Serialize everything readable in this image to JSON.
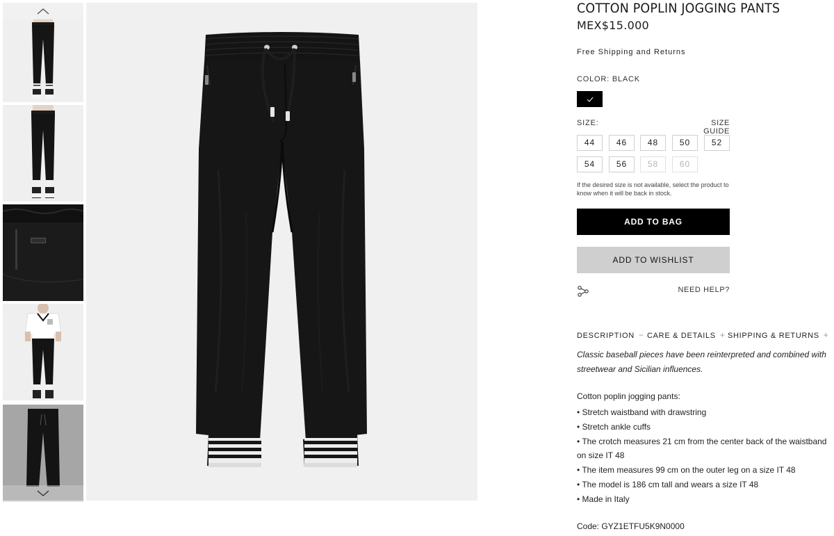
{
  "gallery": {
    "thumbnails": [
      {
        "alt": "front view model"
      },
      {
        "alt": "front view model"
      },
      {
        "alt": "waistband detail"
      },
      {
        "alt": "model with t-shirt"
      },
      {
        "alt": "flat product view"
      }
    ]
  },
  "product": {
    "title": "COTTON POPLIN JOGGING PANTS",
    "price": "MEX$15.000",
    "shipping_note": "Free Shipping and Returns",
    "color_label": "COLOR: BLACK",
    "color_hex": "#000000",
    "size_label": "SIZE:",
    "size_guide": "SIZE GUIDE",
    "sizes": [
      {
        "label": "44",
        "available": true
      },
      {
        "label": "46",
        "available": true
      },
      {
        "label": "48",
        "available": true
      },
      {
        "label": "50",
        "available": true
      },
      {
        "label": "52",
        "available": true
      },
      {
        "label": "54",
        "available": true
      },
      {
        "label": "56",
        "available": true
      },
      {
        "label": "58",
        "available": false
      },
      {
        "label": "60",
        "available": false
      }
    ],
    "size_note": "If the desired size is not available, select the product to know when it will be back in stock.",
    "add_to_bag": "ADD TO BAG",
    "add_to_wishlist": "ADD TO WISHLIST",
    "need_help": "NEED HELP?"
  },
  "tabs": [
    {
      "label": "DESCRIPTION",
      "sign": "−"
    },
    {
      "label": "CARE & DETAILS",
      "sign": "+"
    },
    {
      "label": "SHIPPING & RETURNS",
      "sign": "+"
    }
  ],
  "description": {
    "intro": "Classic baseball pieces have been reinterpreted and combined with streetwear and Sicilian influences.",
    "details_title": "Cotton poplin jogging pants:",
    "bullets": [
      "• Stretch waistband with drawstring",
      "• Stretch ankle cuffs",
      "• The crotch measures 21 cm from the center back of the waistband on size IT 48",
      "• The item measures 99 cm on the outer leg on a size IT 48",
      "• The model is 186 cm tall and wears a size IT 48",
      "• Made in Italy"
    ],
    "code": "Code: GYZ1ETFU5K9N0000"
  }
}
